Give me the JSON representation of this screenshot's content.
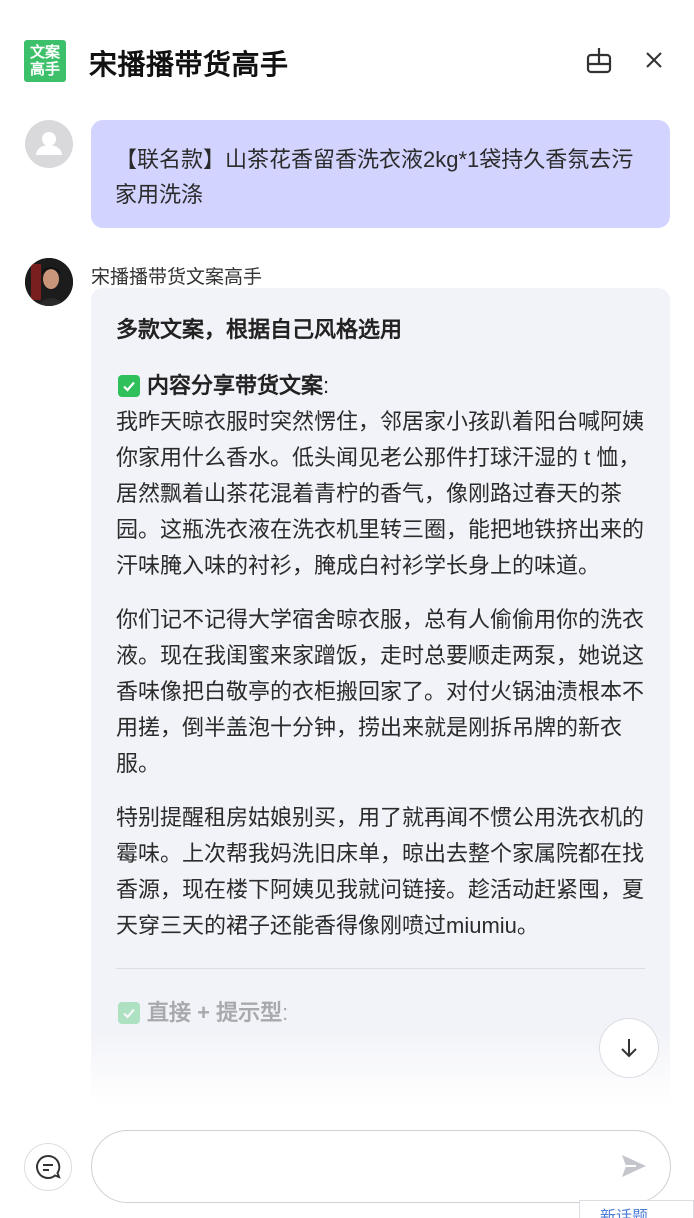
{
  "header": {
    "logo_line1": "文案",
    "logo_line2": "高手",
    "title": "宋播播带货高手",
    "share_icon": "share-box-icon",
    "close_icon": "close-icon"
  },
  "user_message": {
    "text": "【联名款】山茶花香留香洗衣液2kg*1袋持久香氛去污家用洗涤"
  },
  "bot_message": {
    "name": "宋播播带货文案高手",
    "heading": "多款文案，根据自己风格选用",
    "section1": {
      "title": "内容分享带货文案",
      "colon": ":",
      "paragraphs": [
        "我昨天晾衣服时突然愣住，邻居家小孩趴着阳台喊阿姨你家用什么香水。低头闻见老公那件打球汗湿的 t 恤，居然飘着山茶花混着青柠的香气，像刚路过春天的茶园。这瓶洗衣液在洗衣机里转三圈，能把地铁挤出来的汗味腌入味的衬衫，腌成白衬衫学长身上的味道。",
        "你们记不记得大学宿舍晾衣服，总有人偷偷用你的洗衣液。现在我闺蜜来家蹭饭，走时总要顺走两泵，她说这香味像把白敬亭的衣柜搬回家了。对付火锅油渍根本不用搓，倒半盖泡十分钟，捞出来就是刚拆吊牌的新衣服。",
        "特别提醒租房姑娘别买，用了就再闻不惯公用洗衣机的霉味。上次帮我妈洗旧床单，晾出去整个家属院都在找香源，现在楼下阿姨见我就问链接。趁活动赶紧囤，夏天穿三天的裙子还能香得像刚喷过miumiu。"
      ]
    },
    "section2": {
      "title": "直接 + 提示型",
      "colon": ":"
    }
  },
  "input": {
    "value": "",
    "placeholder": ""
  },
  "icons": {
    "new_chat": "new-chat-icon",
    "send": "send-icon",
    "scroll_down": "arrow-down-icon",
    "check": "check-icon"
  },
  "corner_tab_label": "新话题",
  "colors": {
    "accent_green": "#3cc06a",
    "user_bubble": "#d2d4ff",
    "bot_bubble": "#f2f3f8"
  }
}
